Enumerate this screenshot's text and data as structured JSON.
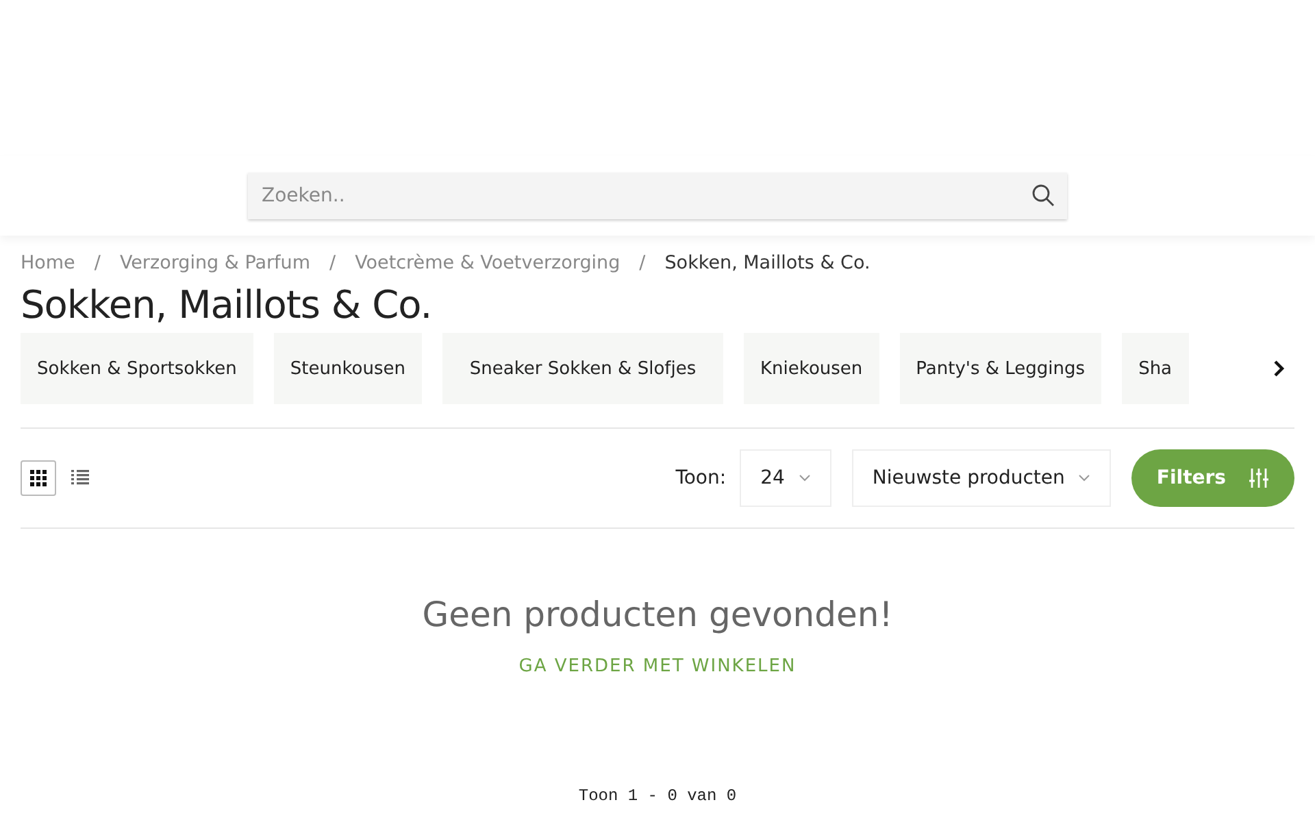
{
  "search": {
    "placeholder": "Zoeken.."
  },
  "breadcrumbs": [
    {
      "label": "Home",
      "current": false
    },
    {
      "label": "Verzorging & Parfum",
      "current": false
    },
    {
      "label": "Voetcrème & Voetverzorging",
      "current": false
    },
    {
      "label": "Sokken, Maillots & Co.",
      "current": true
    }
  ],
  "breadcrumb_separator": "/",
  "title": "Sokken, Maillots & Co.",
  "categories": [
    {
      "label": "Sokken & Sportsokken"
    },
    {
      "label": "Steunkousen"
    },
    {
      "label": "Sneaker Sokken & Slofjes"
    },
    {
      "label": "Kniekousen"
    },
    {
      "label": "Panty's & Leggings"
    },
    {
      "label": "Sha"
    }
  ],
  "toolbar": {
    "views": [
      {
        "kind": "grid",
        "selected": true
      },
      {
        "kind": "list",
        "selected": false
      }
    ],
    "show_label": "Toon:",
    "per_page": "24",
    "sort": "Nieuwste producten",
    "filters_button": "Filters"
  },
  "empty": {
    "message": "Geen producten gevonden!",
    "link": "GA VERDER MET WINKELEN"
  },
  "pagination_summary": "Toon 1 - 0 van 0"
}
